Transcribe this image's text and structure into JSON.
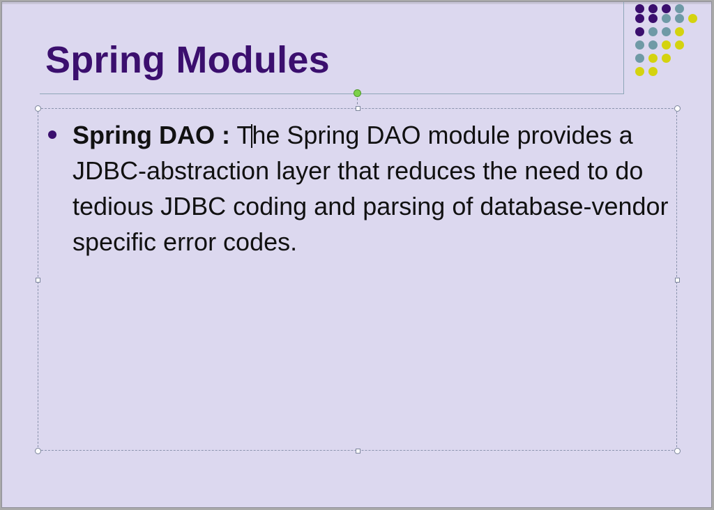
{
  "slide": {
    "title": "Spring Modules",
    "bullet": {
      "label": "Spring DAO :",
      "text_before_cursor": " T",
      "text_after_cursor": "he Spring DAO module provides a JDBC-abstraction layer that reduces the need to do tedious JDBC coding and parsing of database-vendor specific error codes."
    }
  },
  "colors": {
    "background": "#dcd8ef",
    "title": "#3b0f6e",
    "accent_purple": "#3b0f6e",
    "accent_teal": "#6f9aa6",
    "accent_yellow": "#d4d30f",
    "selection_handle_rotate": "#7cd14a"
  }
}
